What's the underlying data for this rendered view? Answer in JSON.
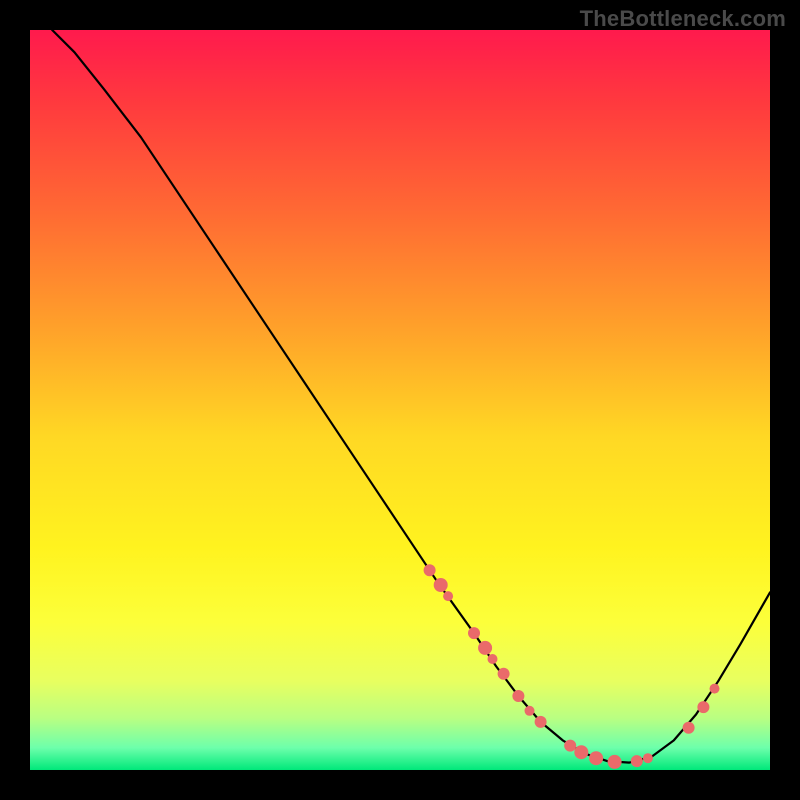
{
  "watermark": "TheBottleneck.com",
  "chart_data": {
    "type": "line",
    "title": "",
    "xlabel": "",
    "ylabel": "",
    "xlim": [
      0,
      100
    ],
    "ylim": [
      0,
      100
    ],
    "grid": false,
    "series": [
      {
        "name": "curve",
        "x": [
          3,
          6,
          10,
          15,
          20,
          25,
          30,
          35,
          40,
          45,
          50,
          55,
          60,
          63,
          66,
          69,
          72,
          75,
          78,
          81,
          84,
          87,
          90,
          93,
          96,
          100
        ],
        "y": [
          100,
          97,
          92,
          85.5,
          78,
          70.5,
          63,
          55.5,
          48,
          40.5,
          33,
          25.5,
          18.5,
          14,
          10,
          6.5,
          4,
          2.2,
          1.2,
          1,
          1.8,
          4,
          7.5,
          12,
          17,
          24
        ]
      }
    ],
    "scatter": [
      {
        "name": "dots",
        "points": [
          {
            "x": 54,
            "y": 27,
            "r": 6
          },
          {
            "x": 55.5,
            "y": 25,
            "r": 7
          },
          {
            "x": 56.5,
            "y": 23.5,
            "r": 5
          },
          {
            "x": 60,
            "y": 18.5,
            "r": 6
          },
          {
            "x": 61.5,
            "y": 16.5,
            "r": 7
          },
          {
            "x": 62.5,
            "y": 15,
            "r": 5
          },
          {
            "x": 64,
            "y": 13,
            "r": 6
          },
          {
            "x": 66,
            "y": 10,
            "r": 6
          },
          {
            "x": 67.5,
            "y": 8,
            "r": 5
          },
          {
            "x": 69,
            "y": 6.5,
            "r": 6
          },
          {
            "x": 73,
            "y": 3.3,
            "r": 6
          },
          {
            "x": 74.5,
            "y": 2.4,
            "r": 7
          },
          {
            "x": 76.5,
            "y": 1.6,
            "r": 7
          },
          {
            "x": 79,
            "y": 1.1,
            "r": 7
          },
          {
            "x": 82,
            "y": 1.2,
            "r": 6
          },
          {
            "x": 83.5,
            "y": 1.6,
            "r": 5
          },
          {
            "x": 89,
            "y": 5.7,
            "r": 6
          },
          {
            "x": 91,
            "y": 8.5,
            "r": 6
          },
          {
            "x": 92.5,
            "y": 11,
            "r": 5
          }
        ]
      }
    ]
  }
}
